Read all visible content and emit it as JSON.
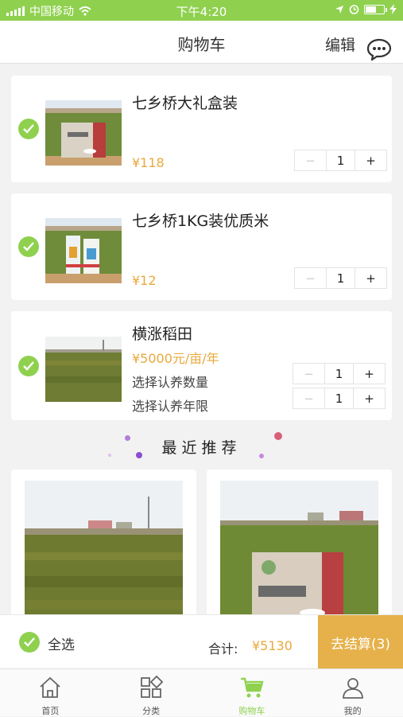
{
  "status_bar": {
    "carrier": "中国移动",
    "time": "下午4:20",
    "battery_level": 0.55
  },
  "nav": {
    "title": "购物车",
    "edit_label": "编辑"
  },
  "colors": {
    "accent": "#8fd14f",
    "price": "#e8a93c",
    "checkout_button": "#e6b14a"
  },
  "cart_items": [
    {
      "name": "七乡桥大礼盒装",
      "price": "¥118",
      "quantity": "1",
      "selected": true
    },
    {
      "name": "七乡桥1KG装优质米",
      "price": "¥12",
      "quantity": "1",
      "selected": true
    },
    {
      "name": "横涨稻田",
      "price": "¥5000元/亩/年",
      "selected": true,
      "options": [
        {
          "label": "选择认养数量",
          "quantity": "1"
        },
        {
          "label": "选择认养年限",
          "quantity": "1"
        }
      ]
    }
  ],
  "stepper": {
    "minus": "−",
    "plus": "+"
  },
  "recommend": {
    "title": "最近推荐"
  },
  "checkout": {
    "select_all_label": "全选",
    "total_label": "合计:",
    "total_value": "¥5130",
    "button_label": "去结算(3)"
  },
  "tabs": [
    {
      "label": "首页",
      "icon": "home-icon"
    },
    {
      "label": "分类",
      "icon": "category-icon"
    },
    {
      "label": "购物车",
      "icon": "cart-icon",
      "active": true
    },
    {
      "label": "我的",
      "icon": "profile-icon"
    }
  ]
}
